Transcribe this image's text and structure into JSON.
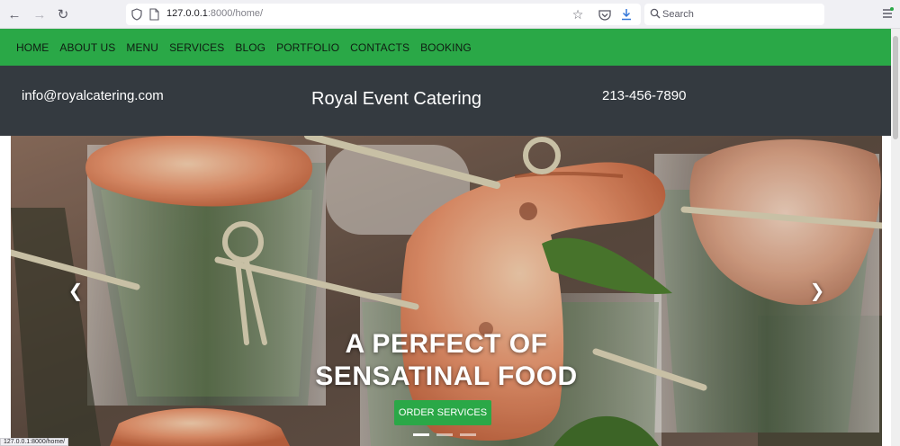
{
  "browser": {
    "url_host": "127.0.0.1",
    "url_path": ":8000/home/",
    "search_placeholder": "Search",
    "icons": [
      "back-icon",
      "forward-icon",
      "reload-icon",
      "shield-icon",
      "page-icon",
      "star-icon",
      "pocket-icon",
      "download-icon",
      "search-icon",
      "menu-icon"
    ]
  },
  "nav": {
    "items": [
      "HOME",
      "ABOUT US",
      "MENU",
      "SERVICES",
      "BLOG",
      "PORTFOLIO",
      "CONTACTS",
      "BOOKING"
    ]
  },
  "header": {
    "email": "info@royalcatering.com",
    "title": "Royal Event Catering",
    "phone": "213-456-7890"
  },
  "hero": {
    "title_line1": "A PERFECT OF",
    "title_line2": "SENSATINAL FOOD",
    "button_label": "ORDER SERVICES",
    "slide_count": 3,
    "active_slide": 1
  },
  "status_link": "127.0.0.1:8000/home/",
  "colors": {
    "nav_green": "#2aa847",
    "header_dark": "#343a40"
  }
}
